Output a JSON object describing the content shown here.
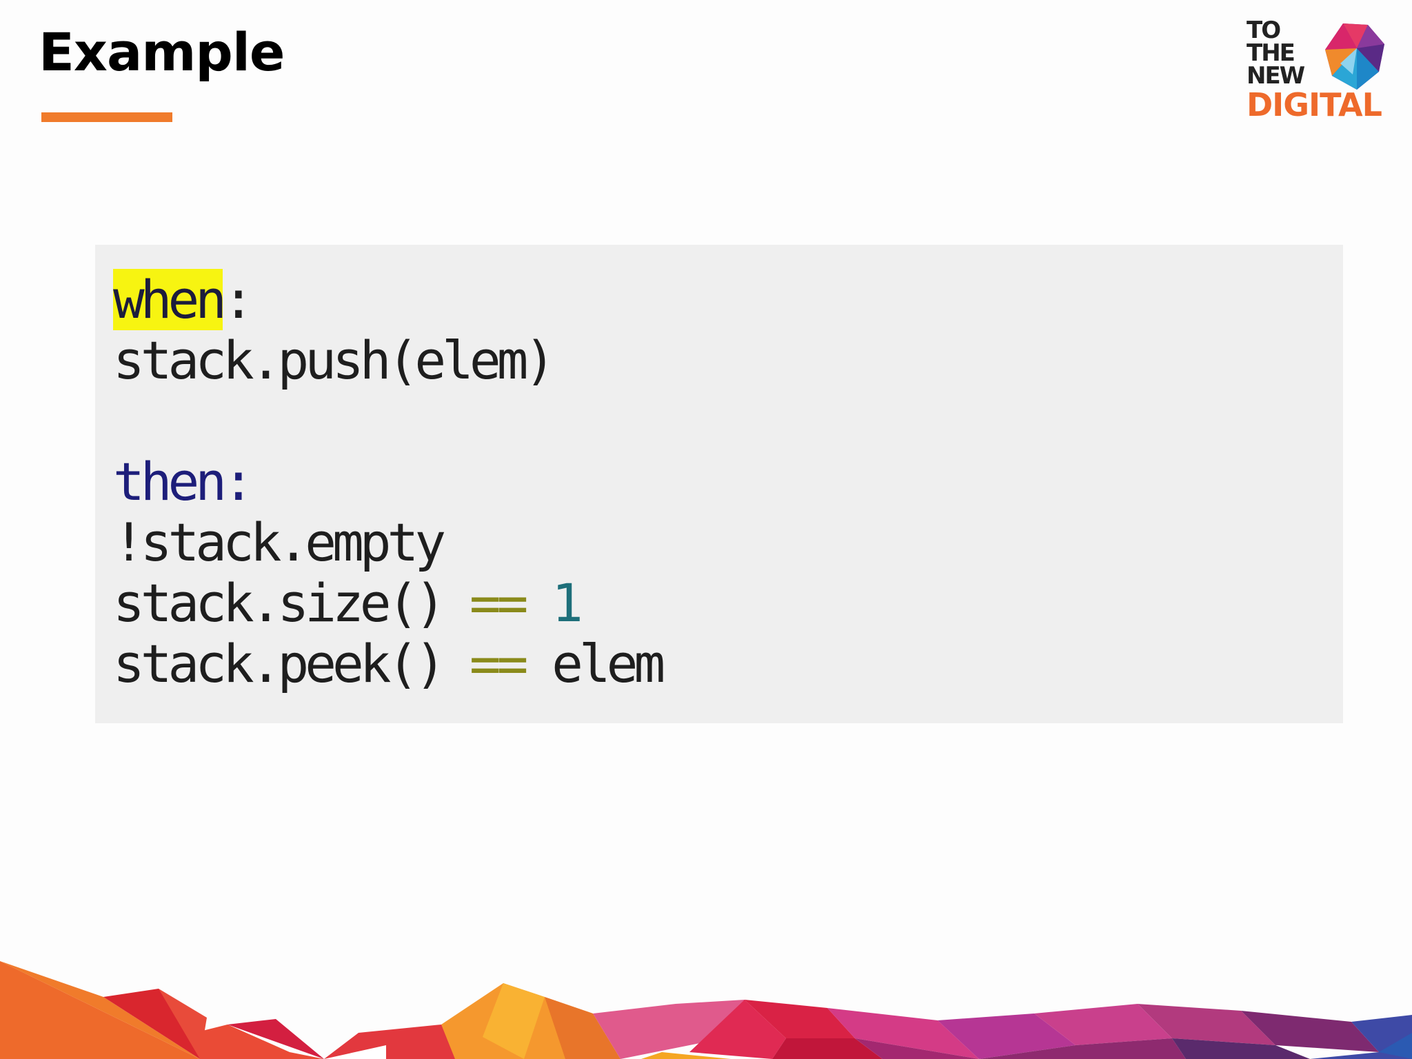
{
  "slide": {
    "title": "Example"
  },
  "logo": {
    "line1": "TO",
    "line2": "THE",
    "line3": "NEW",
    "line4": "DIGITAL"
  },
  "code": {
    "line1_keyword": "when",
    "line1_rest": ":",
    "line2": "stack.push(elem)",
    "line4_keyword": "then",
    "line4_rest": ":",
    "line5": "!stack.empty",
    "line6_head": "stack.size()",
    "line6_op": "==",
    "line6_value": "1",
    "line7_head": "stack.peek()",
    "line7_op": "==",
    "line7_value": "elem"
  },
  "colors": {
    "accent": "#f07b2b",
    "highlight": "#f7f411",
    "code_background": "#efefef"
  }
}
